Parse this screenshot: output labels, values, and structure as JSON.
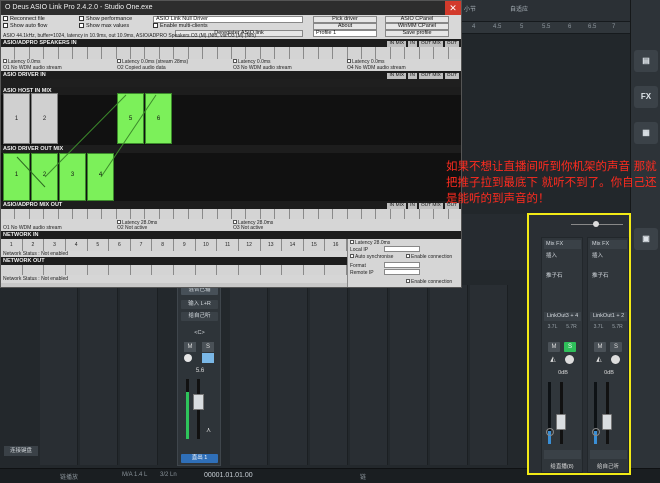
{
  "asio": {
    "title": "O Deus ASIO Link Pro 2.4.2.0 - Studio One.exe",
    "close": "✕",
    "checks": [
      "Reconnect file",
      "Show auto flow",
      "Show performance",
      "Show max values",
      "Enable multi-clients"
    ],
    "driver_label": "ASIO Link Null Driver",
    "buttons": [
      "Pick driver",
      "ASIO CPanel",
      "About",
      "WinMM CPanel",
      "Save profile"
    ],
    "deregister": "Deregister ASIO link",
    "profile": "Profile 1",
    "status_line": "ASIO 44.1kHz, buffer=1024, latency in 10.9ms, out 10.9ms, ASIO/ADPRO Speakers O3 (M) (Nfo, via O3 (M) (Nfo)",
    "sections": {
      "speakers_in": "ASIO/ADPRO SPEAKERS IN",
      "driver_in": "ASIO DRIVER IN",
      "host_in_mix": "ASIO HOST IN MIX",
      "driver_out_mix": "ASIO DRIVER OUT MIX",
      "adpro_mix_out": "ASIO/ADPRO MIX OUT",
      "network_in": "NETWORK IN",
      "network_out": "NETWORK OUT"
    },
    "sec_buttons": [
      "IN MIX",
      "IN",
      "OUT MIX",
      "OUT"
    ],
    "latency": [
      "Latency 0.0ms",
      "Latency 0.0ms (stream 28ms)",
      "Latency 0.0ms",
      "Latency 0.0ms"
    ],
    "ch_streams": [
      "O1 No WDM audio stream",
      "O2 Copied audio data",
      "O3 No WDM audio stream",
      "O4 No WDM audio stream"
    ],
    "host_blocks": [
      "1",
      "2",
      "5",
      "6"
    ],
    "driver_blocks": [
      "1",
      "2",
      "3",
      "4"
    ],
    "mix_out_latency": [
      "Latency 28.0ms",
      "Latency 28.0ms",
      "Latency 28.0ms"
    ],
    "mix_out_streams": [
      "O1 No WDM audio stream",
      "O2 Not active",
      "O3 Not active"
    ],
    "numbers_16": [
      "1",
      "2",
      "3",
      "4",
      "5",
      "6",
      "7",
      "8",
      "9",
      "10",
      "11",
      "12",
      "13",
      "14",
      "15",
      "16"
    ],
    "network_status_in": "Network Status : Not enabled",
    "network_status_out": "Network Status : Not enabled",
    "net_side": {
      "latency": "Latency 28.0ms",
      "local_ip": "Local IP",
      "auto_sync": "Auto synchronise",
      "format": "Format",
      "remote_ip": "Remote IP",
      "enable_conn": "Enable connection"
    }
  },
  "daw": {
    "topbar": [
      "小节",
      "自适应"
    ],
    "ruler": [
      "4",
      "4.5",
      "5",
      "5.5",
      "6",
      "6.5",
      "7"
    ],
    "rightstrip": [
      "▤",
      "FX",
      "▦",
      "▣"
    ],
    "bottom": [
      "链播放",
      "M/A 1.4 L",
      "3/2 Ln",
      "00001.01.01.00",
      "链"
    ],
    "center_strip": {
      "header": "混合已输",
      "input": "输入 L+R",
      "output": "给自己听",
      "pan": "<C>",
      "m": "M",
      "s": "S",
      "level": "5.6",
      "footer": "直出 1"
    },
    "left_track_label": "连接键盘"
  },
  "annotation": "如果不想让直播间听到你机架的声音 那就把推子拉到最底下 就听不到了。你自己还是能听的到声音的！",
  "mixer": {
    "channels": [
      {
        "fx": "Mix FX",
        "insert": "插入",
        "send": "推子石",
        "name": "LinkOut3 + 4",
        "pan_l": "3.7L",
        "pan_r": "5.7R",
        "m": "M",
        "s": "S",
        "level": "0dB",
        "bottom": "给直播(8)"
      },
      {
        "fx": "Mix FX",
        "insert": "插入",
        "send": "推子石",
        "name": "LinkOut1 + 2",
        "pan_l": "3.7L",
        "pan_r": "5.7R",
        "m": "M",
        "s": "S",
        "level": "0dB",
        "bottom": "给自己听"
      }
    ],
    "fader_level_fraction": 0.35,
    "accent": "#f2ea16",
    "solo_color": "#2fbf5a"
  }
}
